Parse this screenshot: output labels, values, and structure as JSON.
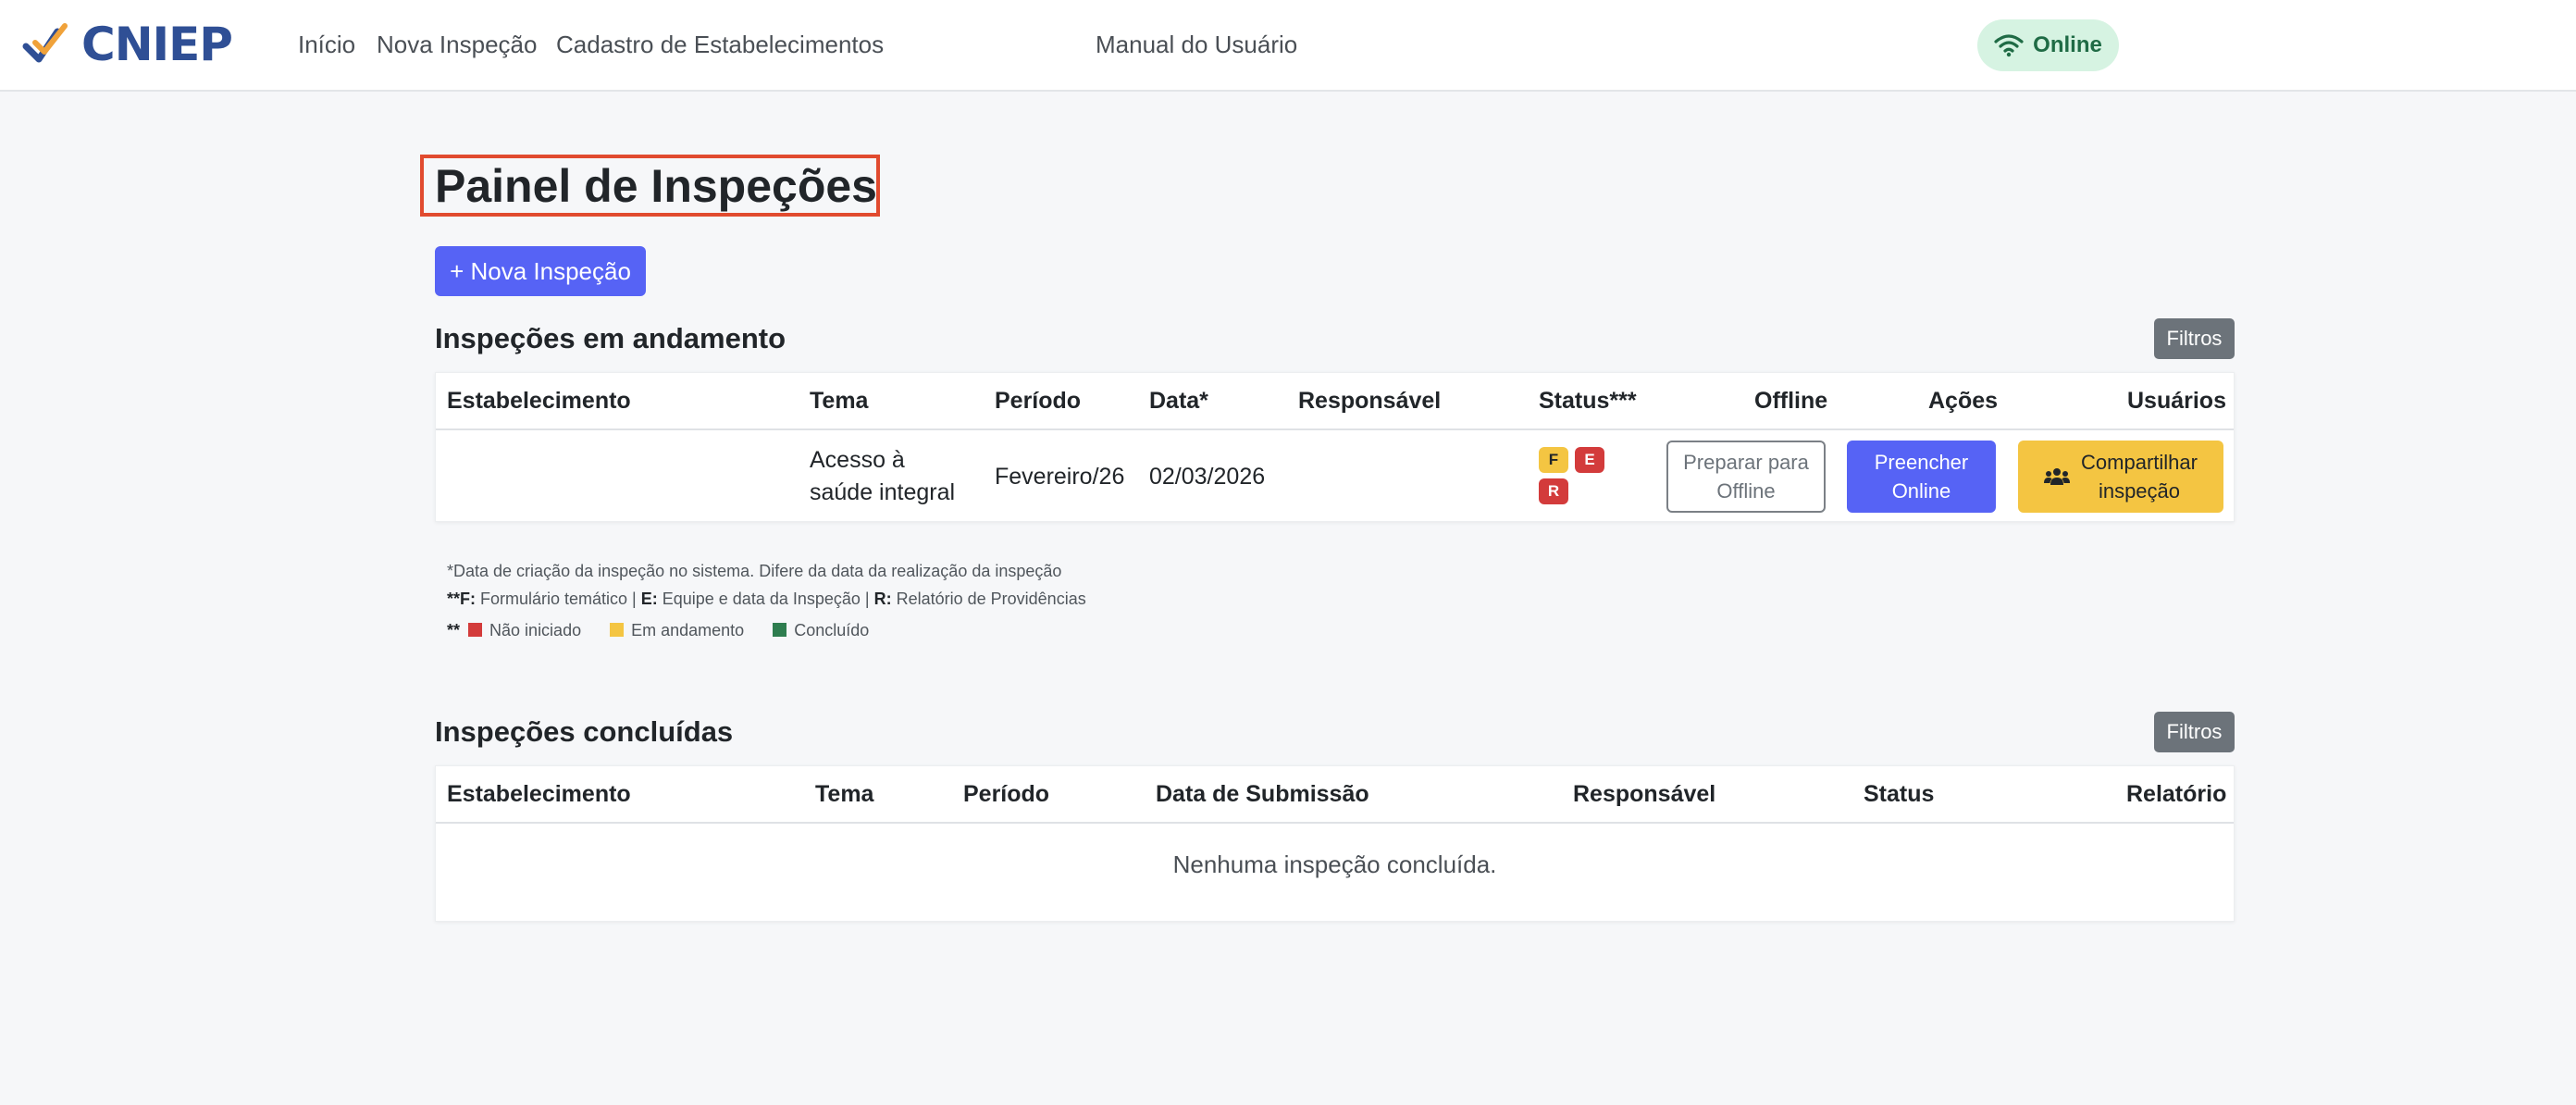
{
  "app": {
    "logo_text": "CNIEP",
    "nav": [
      "Início",
      "Nova Inspeção",
      "Cadastro de Estabelecimentos",
      "Manual do Usuário"
    ],
    "connection_status": "Online"
  },
  "page": {
    "title": "Painel de Inspeções",
    "new_button": "+ Nova Inspeção"
  },
  "in_progress": {
    "title": "Inspeções em andamento",
    "filter_button": "Filtros",
    "columns": [
      "Estabelecimento",
      "Tema",
      "Período",
      "Data*",
      "Responsável",
      "Status***",
      "Offline",
      "Ações",
      "Usuários"
    ],
    "rows": [
      {
        "estabelecimento": "",
        "tema_line1": "Acesso à",
        "tema_line2": "saúde integral",
        "periodo": "Fevereiro/26",
        "data": "02/03/2026",
        "responsavel": "",
        "status": [
          {
            "label": "F",
            "color": "#f4c542"
          },
          {
            "label": "E",
            "color": "#d33b3b"
          },
          {
            "label": "R",
            "color": "#d33b3b"
          }
        ],
        "offline_button_line1": "Preparar para",
        "offline_button_line2": "Offline",
        "action_button_line1": "Preencher",
        "action_button_line2": "Online",
        "share_button_line1": "Compartilhar",
        "share_button_line2": "inspeção",
        "share_icon": "users-icon"
      }
    ],
    "notes": {
      "line1": "*Data de criação da inspeção no sistema. Difere da data da realização da inspeção",
      "line2_prefix": "**F:",
      "line2_f": " Formulário temático | ",
      "line2_e_key": "E:",
      "line2_e": " Equipe e data da Inspeção | ",
      "line2_r_key": "R:",
      "line2_r": " Relatório de Providências",
      "line3_prefix": "**",
      "legend": [
        {
          "label": "Não iniciado",
          "color": "#d33b3b"
        },
        {
          "label": "Em andamento",
          "color": "#f4c542"
        },
        {
          "label": "Concluído",
          "color": "#2e7d4f"
        }
      ]
    }
  },
  "completed": {
    "title": "Inspeções concluídas",
    "filter_button": "Filtros",
    "columns": [
      "Estabelecimento",
      "Tema",
      "Período",
      "Data de Submissão",
      "Responsável",
      "Status",
      "Relatório"
    ],
    "empty_message": "Nenhuma inspeção concluída."
  },
  "colors": {
    "primary": "#5663f5",
    "warning": "#f4c542",
    "danger": "#d33b3b",
    "success": "#2e7d4f",
    "highlight_box": "#e14b2f"
  }
}
